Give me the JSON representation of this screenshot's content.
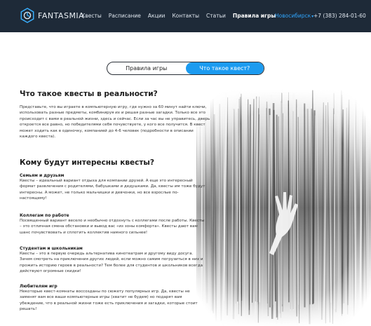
{
  "header": {
    "brand": "FANTASMIA",
    "nav": [
      "Квесты",
      "Расписание",
      "Акции",
      "Контакты",
      "Статьи",
      "Правила игры"
    ],
    "active_nav": "Правила игры",
    "city": "Новосибирск",
    "phone": "+7 (383) 284-01-60",
    "colors": {
      "bar": "#1e2a38",
      "accent": "#2fa6ff"
    }
  },
  "tabs": {
    "rules": "Правила игры",
    "what_is": "Что такое квест?",
    "selected": "Что такое квест?"
  },
  "article": {
    "title": "Что такое квесты в реальности?",
    "intro": "Представьте, что вы играете в компьютерную игру, где нужно за 60 минут найти ключи, использовать разные предметы, комбинируя их и решая разные загадки. Только все это происходит с вами в реальной жизни, здесь и сейчас. Если за час вы не управитесь, дверь откроется все равно, но победителями себя почувствуете, у кого все получится. В квест может ходить как в одиночку, компанией до 4-6 человек (подробности в описании каждого квеста).",
    "audience_title": "Кому будут интересны квесты?",
    "sections": [
      {
        "title": "Семьям и друзьям",
        "text": "Квесты – идеальный вариант отдыха для компании друзей. А еще это интересный формат развлечения с родителями, бабушками и дедушками. Да, квесты им тоже будут интересны. А может, не только мальчишки и девчонки, но все взрослые по-настоящему!"
      },
      {
        "title": "Коллегам по работе",
        "text": "Посвященный вариант весело и необычно отдохнуть с коллегами после работы. Квесты – это отличная смена обстановки и вывод вас «из зоны комфорта». Квесты дают вам шанс почувствовать и сплотить коллектив намного сильнее!"
      },
      {
        "title": "Студентам и школьникам",
        "text": "Квесты – это в первую очередь альтернатива кинотеатрам и другому виду досуга. Зачем смотреть на приключения других людей, если можно самим погрузиться в них и прожить историю героев в реальности? Тем более для студентов и школьников всегда действуют огромные скидки!"
      },
      {
        "title": "Любителям игр",
        "text": "Некоторые квест-комнаты воссозданы по сюжету популярных игр. Да, квесты не заменят вам все ваши компьютерные игры (хватит не будем) но подарят вам убеждение, что в реальной жизни тоже есть приключения и загадки, которые стоит решать!"
      }
    ]
  }
}
